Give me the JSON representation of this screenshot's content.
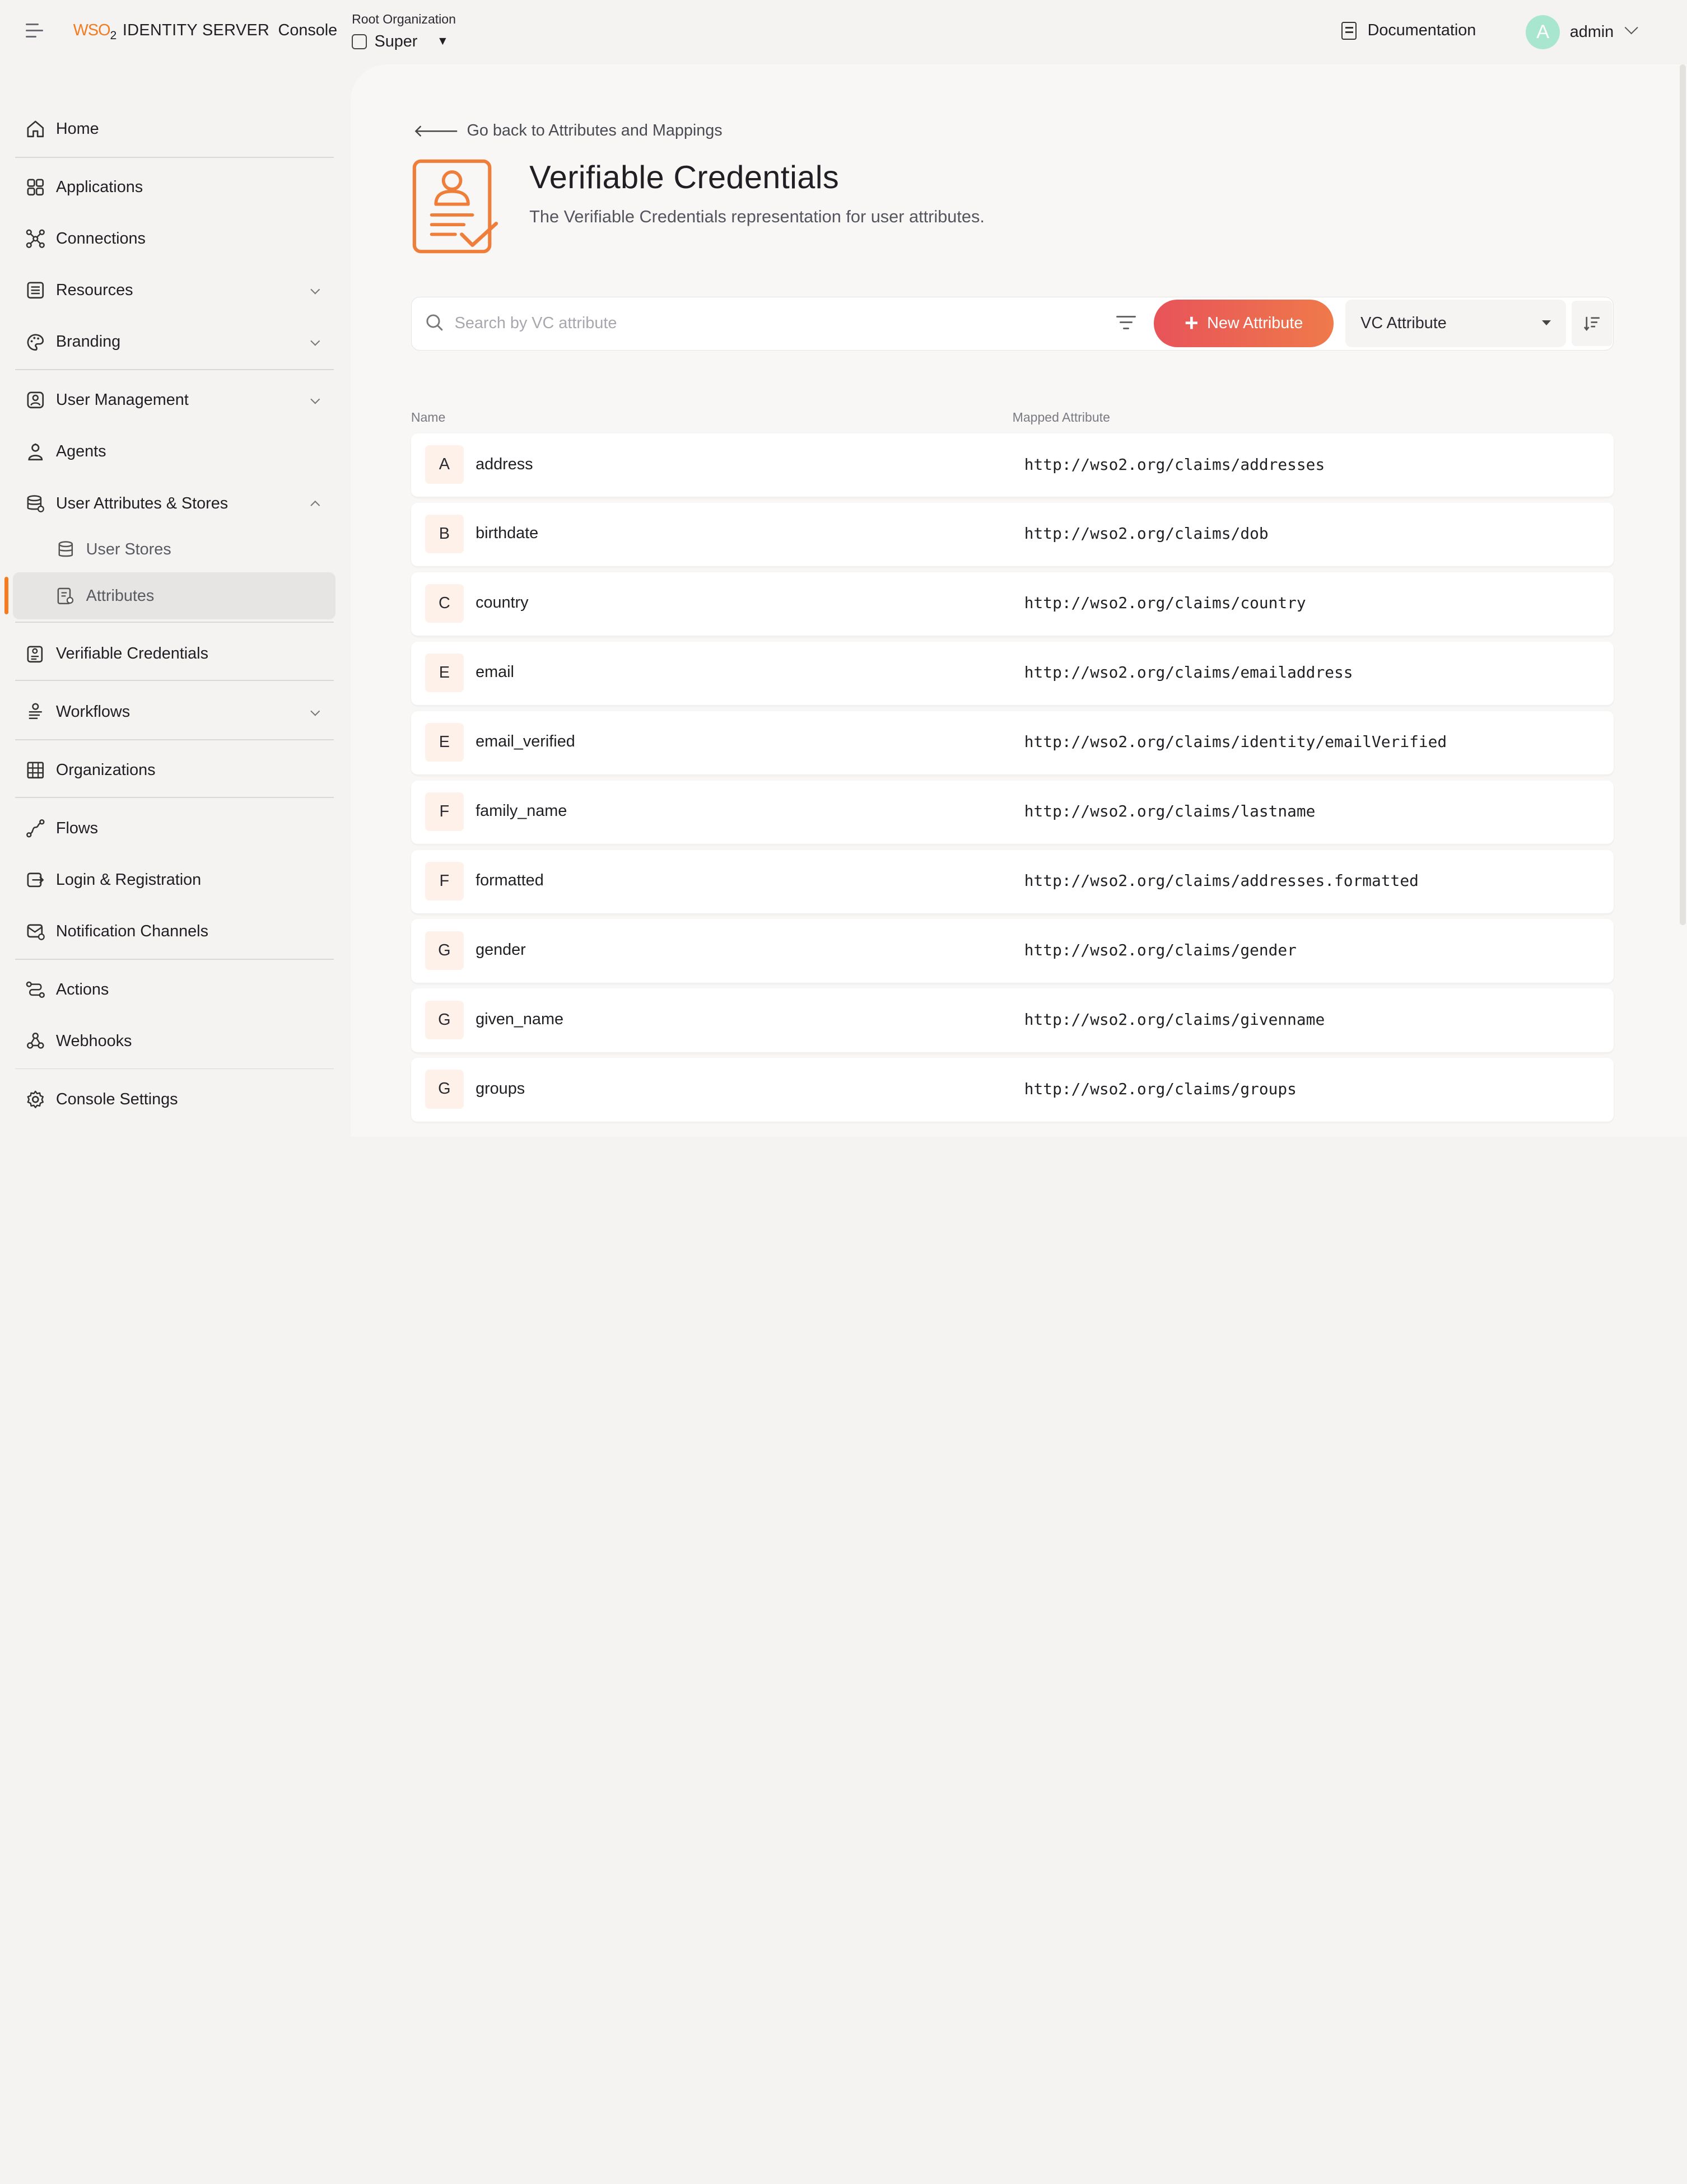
{
  "header": {
    "brand_wso2": "WSO",
    "brand_wso2_sub": "2",
    "brand_product": "IDENTITY SERVER",
    "brand_console": "Console",
    "org_label": "Root Organization",
    "org_name": "Super",
    "documentation": "Documentation",
    "avatar_letter": "A",
    "user_name": "admin"
  },
  "sidebar": {
    "items": [
      {
        "label": "Home",
        "icon": "home-icon"
      },
      {
        "label": "Applications",
        "icon": "grid-icon"
      },
      {
        "label": "Connections",
        "icon": "connections-icon"
      },
      {
        "label": "Resources",
        "icon": "resources-icon"
      },
      {
        "label": "Branding",
        "icon": "palette-icon"
      },
      {
        "label": "User Management",
        "icon": "user-management-icon"
      },
      {
        "label": "Agents",
        "icon": "agent-icon"
      },
      {
        "label": "User Attributes & Stores",
        "icon": "database-icon"
      },
      {
        "label": "User Stores",
        "icon": "user-stores-icon"
      },
      {
        "label": "Attributes",
        "icon": "attributes-icon"
      },
      {
        "label": "Verifiable Credentials",
        "icon": "credentials-icon"
      },
      {
        "label": "Workflows",
        "icon": "workflow-icon"
      },
      {
        "label": "Organizations",
        "icon": "building-icon"
      },
      {
        "label": "Flows",
        "icon": "flows-icon"
      },
      {
        "label": "Login & Registration",
        "icon": "login-icon"
      },
      {
        "label": "Notification Channels",
        "icon": "notification-icon"
      },
      {
        "label": "Actions",
        "icon": "actions-icon"
      },
      {
        "label": "Webhooks",
        "icon": "webhooks-icon"
      },
      {
        "label": "Console Settings",
        "icon": "gear-icon"
      }
    ]
  },
  "main": {
    "back_link": "Go back to Attributes and Mappings",
    "title": "Verifiable Credentials",
    "description": "The Verifiable Credentials representation for user attributes.",
    "search_placeholder": "Search by VC attribute",
    "new_button": "New Attribute",
    "select_value": "VC Attribute",
    "columns": {
      "name": "Name",
      "mapped": "Mapped Attribute"
    },
    "rows": [
      {
        "letter": "A",
        "name": "address",
        "mapped": "http://wso2.org/claims/addresses"
      },
      {
        "letter": "B",
        "name": "birthdate",
        "mapped": "http://wso2.org/claims/dob"
      },
      {
        "letter": "C",
        "name": "country",
        "mapped": "http://wso2.org/claims/country"
      },
      {
        "letter": "E",
        "name": "email",
        "mapped": "http://wso2.org/claims/emailaddress"
      },
      {
        "letter": "E",
        "name": "email_verified",
        "mapped": "http://wso2.org/claims/identity/emailVerified"
      },
      {
        "letter": "F",
        "name": "family_name",
        "mapped": "http://wso2.org/claims/lastname"
      },
      {
        "letter": "F",
        "name": "formatted",
        "mapped": "http://wso2.org/claims/addresses.formatted"
      },
      {
        "letter": "G",
        "name": "gender",
        "mapped": "http://wso2.org/claims/gender"
      },
      {
        "letter": "G",
        "name": "given_name",
        "mapped": "http://wso2.org/claims/givenname"
      },
      {
        "letter": "G",
        "name": "groups",
        "mapped": "http://wso2.org/claims/groups"
      }
    ]
  },
  "colors": {
    "accent": "#f47b20",
    "button_start": "#e8535a",
    "button_end": "#ef7a4a",
    "avatar": "#a8e6d0"
  }
}
